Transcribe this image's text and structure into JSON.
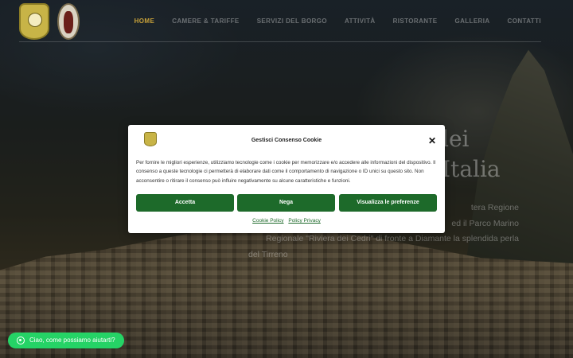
{
  "nav": {
    "items": [
      "HOME",
      "CAMERE & TARIFFE",
      "SERVIZI DEL BORGO",
      "ATTIVITÀ",
      "RISTORANTE",
      "GALLERIA",
      "CONTATTI"
    ],
    "accent": "#c9a23a"
  },
  "hero": {
    "title_lines": [
      "lei",
      "Italia"
    ],
    "paragraph_lines": [
      "tera Regione",
      "ed il Parco Marino",
      "Regionale \"Riviera dei Cedri\" di fronte a Diamante la splendida perla",
      "del Tirreno"
    ]
  },
  "cookie": {
    "title": "Gestisci Consenso Cookie",
    "close_icon": "close-icon",
    "message": "Per fornire le migliori esperienze, utilizziamo tecnologie come i cookie per memorizzare e/o accedere alle informazioni del dispositivo. Il consenso a queste tecnologie ci permetterà di elaborare dati come il comportamento di navigazione o ID unici su questo sito. Non acconsentire o ritirare il consenso può influire negativamente su alcune caratteristiche e funzioni.",
    "accept_label": "Accetta",
    "deny_label": "Nega",
    "prefs_label": "Visualizza le preferenze",
    "link_cookie_policy": "Cookie Policy",
    "link_privacy_policy": "Policy Privacy",
    "button_color": "#1d6a2a"
  },
  "chat": {
    "label": "Ciao, come possiamo aiutarti?",
    "icon": "whatsapp-icon",
    "color": "#25d366"
  }
}
